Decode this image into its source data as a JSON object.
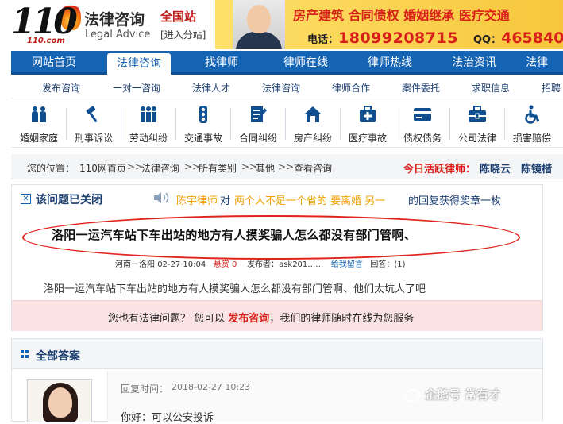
{
  "header": {
    "logo_number": "110",
    "logo_url": "110.com",
    "site_name": "法律咨询",
    "site_name_en": "Legal Advice",
    "region": "全国站",
    "region_switch": "[进入分站]",
    "banner": {
      "tags": "房产建筑 合同债权 婚姻继承 医疗交通",
      "phone_label": "电话：",
      "phone": "18099208715",
      "qq_label": "QQ：",
      "qq": "465840"
    }
  },
  "nav": {
    "items": [
      "网站首页",
      "法律咨询",
      "找律师",
      "律师在线",
      "律师热线",
      "法治资讯",
      "法律"
    ]
  },
  "subnav": {
    "items": [
      "发布咨询",
      "一对一咨询",
      "法律人才",
      "法律咨询",
      "律师合作",
      "案件委托",
      "求职信息",
      "招聘"
    ]
  },
  "categories": [
    {
      "label": "婚姻家庭",
      "icon": "family-icon"
    },
    {
      "label": "刑事诉讼",
      "icon": "gavel-icon"
    },
    {
      "label": "劳动纠纷",
      "icon": "workers-icon"
    },
    {
      "label": "交通事故",
      "icon": "traffic-light-icon"
    },
    {
      "label": "合同纠纷",
      "icon": "contract-icon"
    },
    {
      "label": "房产纠纷",
      "icon": "house-icon"
    },
    {
      "label": "医疗事故",
      "icon": "medical-icon"
    },
    {
      "label": "债权债务",
      "icon": "card-icon"
    },
    {
      "label": "公司法律",
      "icon": "briefcase-icon"
    },
    {
      "label": "损害赔偿",
      "icon": "wheelchair-icon"
    }
  ],
  "breadcrumb": {
    "label": "您的位置：",
    "items": [
      "110网首页",
      "法律咨询",
      "所有类别",
      "其他",
      "查看咨询"
    ],
    "separator": ">>",
    "active_label": "今日活跃律师：",
    "lawyers": [
      "陈晓云",
      "陈镜楷"
    ]
  },
  "question": {
    "status": "该问题已关闭",
    "award": {
      "lawyer": "陈宇律师",
      "mid": "对",
      "question": "两个人不是一个省的 要离婚 另一",
      "tail": "的回复获得奖章一枚"
    },
    "title": "洛阳一运汽车站下车出站的地方有人摸奖骗人怎么都没有部门管啊、",
    "meta": {
      "location": "河南－洛阳",
      "date": "02-27 10:04",
      "reward": "悬赏 0",
      "author_label": "发布者：",
      "author": "ask201……",
      "message_link": "给我留言",
      "replies": "回答：(1)"
    },
    "body": "洛阳一运汽车站下车出站的地方有人摸奖骗人怎么都没有部门管啊、他们太坑人了吧",
    "prompt": {
      "before": "您也有法律问题？ 您可以",
      "link": "发布咨询",
      "after": "，我们的律师随时在线为您服务"
    }
  },
  "answers": {
    "title": "全部答案",
    "reply_time_label": "回复时间：",
    "reply_time": "2018-02-27 10:23",
    "reply_text": "你好：可以公安投诉"
  },
  "watermark": "企鹅号 常有才",
  "colors": {
    "nav_blue": "#1563b3",
    "accent_red": "#d8201a",
    "award_orange": "#f0a000",
    "band_pink": "#fbe3e3"
  }
}
